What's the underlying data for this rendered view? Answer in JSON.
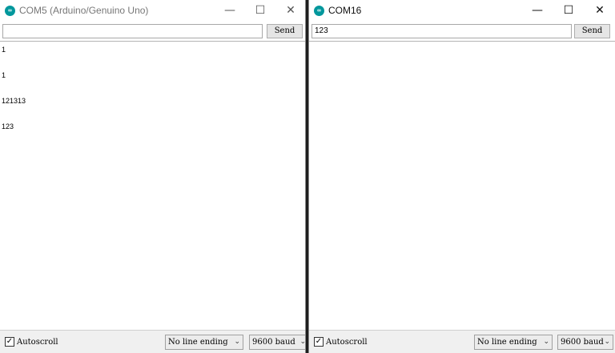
{
  "colors": {
    "app_icon": "#00979c"
  },
  "left_window": {
    "title": "COM5 (Arduino/Genuino Uno)",
    "icon": "arduino-icon",
    "controls": {
      "minimize": "—",
      "maximize": "☐",
      "close": "✕"
    },
    "input_value": "",
    "send_label": "Send",
    "output_lines": [
      "1",
      "1",
      "121313",
      "123"
    ],
    "autoscroll_label": "Autoscroll",
    "autoscroll_checked": true,
    "line_ending": "No line ending",
    "baud": "9600 baud"
  },
  "right_window": {
    "title": "COM16",
    "icon": "arduino-icon",
    "controls": {
      "minimize": "—",
      "maximize": "☐",
      "close": "✕"
    },
    "input_value": "123",
    "send_label": "Send",
    "output_lines": [],
    "autoscroll_label": "Autoscroll",
    "autoscroll_checked": true,
    "line_ending": "No line ending",
    "baud": "9600 baud"
  }
}
